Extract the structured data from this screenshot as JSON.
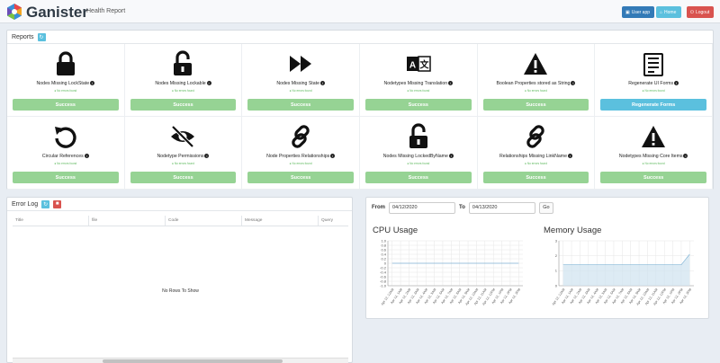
{
  "header": {
    "brand": "Ganister",
    "subtitle": "Health Report",
    "buttons": {
      "user_app": "User app",
      "home": "Home",
      "logout": "Logout"
    }
  },
  "reports": {
    "title": "Reports",
    "status_text": "No errors found",
    "cards": [
      {
        "label": "Nodes Missing LockState",
        "button": "Success",
        "icon": "lock-icon",
        "button_style": "success"
      },
      {
        "label": "Nodes Missing Lockable",
        "button": "Success",
        "icon": "lock-open-icon",
        "button_style": "success"
      },
      {
        "label": "Nodes Missing State",
        "button": "Success",
        "icon": "fast-forward-icon",
        "button_style": "success"
      },
      {
        "label": "Nodetypes Missing Translation",
        "button": "Success",
        "icon": "language-icon",
        "button_style": "success"
      },
      {
        "label": "Boolean Properties stored as String",
        "button": "Success",
        "icon": "warning-icon",
        "button_style": "success"
      },
      {
        "label": "Regenerate UI Forms",
        "button": "Regenerate Forms",
        "icon": "form-icon",
        "button_style": "info"
      },
      {
        "label": "Circular References",
        "button": "Success",
        "icon": "undo-icon",
        "button_style": "success"
      },
      {
        "label": "Nodetype Permissions",
        "button": "Success",
        "icon": "eye-slash-icon",
        "button_style": "success"
      },
      {
        "label": "Node Properties Relationships",
        "button": "Success",
        "icon": "link-icon",
        "button_style": "success"
      },
      {
        "label": "Nodes Missing LockedByName",
        "button": "Success",
        "icon": "lock-open-icon",
        "button_style": "success"
      },
      {
        "label": "Relationships Missing LinkName",
        "button": "Success",
        "icon": "link-icon",
        "button_style": "success"
      },
      {
        "label": "Nodetypes Missing Core Items",
        "button": "Success",
        "icon": "warning-icon",
        "button_style": "success"
      }
    ]
  },
  "error_log": {
    "title": "Error Log",
    "columns": [
      "Title",
      "file",
      "Code",
      "Message",
      "Query"
    ],
    "empty_text": "No Rows To Show"
  },
  "metrics": {
    "from_label": "From",
    "to_label": "To",
    "from_date": "04/12/2020",
    "to_date": "04/13/2020",
    "go_label": "Go"
  },
  "chart_data": [
    {
      "type": "line",
      "title": "CPU Usage",
      "ylim": [
        -1.0,
        1.0
      ],
      "yticks": [
        "1.0",
        "0.8",
        "0.6",
        "0.4",
        "0.2",
        "0",
        "-0.2",
        "-0.4",
        "-0.6",
        "-0.8",
        "-1.0"
      ],
      "xticks": [
        "Apr 12, 12AM",
        "Apr 12, 1AM",
        "Apr 12, 2AM",
        "Apr 12, 3AM",
        "Apr 12, 4AM",
        "Apr 12, 5AM",
        "Apr 12, 6AM",
        "Apr 12, 7AM",
        "Apr 12, 8AM",
        "Apr 12, 9AM",
        "Apr 12, 10AM",
        "Apr 12, 11AM",
        "Apr 12, 12PM",
        "Apr 12, 1PM",
        "Apr 12, 2PM",
        "Apr 12, 3PM"
      ],
      "series": [
        {
          "values": [
            0,
            0,
            0,
            0,
            0,
            0,
            0,
            0,
            0,
            0,
            0,
            0,
            0,
            0,
            0,
            0
          ]
        }
      ],
      "grid": true
    },
    {
      "type": "area",
      "title": "Memory Usage",
      "ylim": [
        0,
        3
      ],
      "yticks": [
        "3",
        "2",
        "1",
        "0"
      ],
      "xticks": [
        "Apr 12, 12AM",
        "Apr 12, 1AM",
        "Apr 12, 2AM",
        "Apr 12, 3AM",
        "Apr 12, 4AM",
        "Apr 12, 5AM",
        "Apr 12, 6AM",
        "Apr 12, 7AM",
        "Apr 12, 8AM",
        "Apr 12, 9AM",
        "Apr 12, 10AM",
        "Apr 12, 11AM",
        "Apr 12, 12PM",
        "Apr 12, 1PM",
        "Apr 12, 2PM",
        "Apr 12, 3PM"
      ],
      "series": [
        {
          "values": [
            1.4,
            1.4,
            1.4,
            1.4,
            1.4,
            1.4,
            1.4,
            1.4,
            1.4,
            1.4,
            1.4,
            1.4,
            1.4,
            1.4,
            1.4,
            2.1
          ]
        }
      ],
      "grid": true
    }
  ],
  "colors": {
    "success": "#96d394",
    "info": "#5bc0de",
    "primary": "#337ab7",
    "danger": "#d9534f"
  }
}
